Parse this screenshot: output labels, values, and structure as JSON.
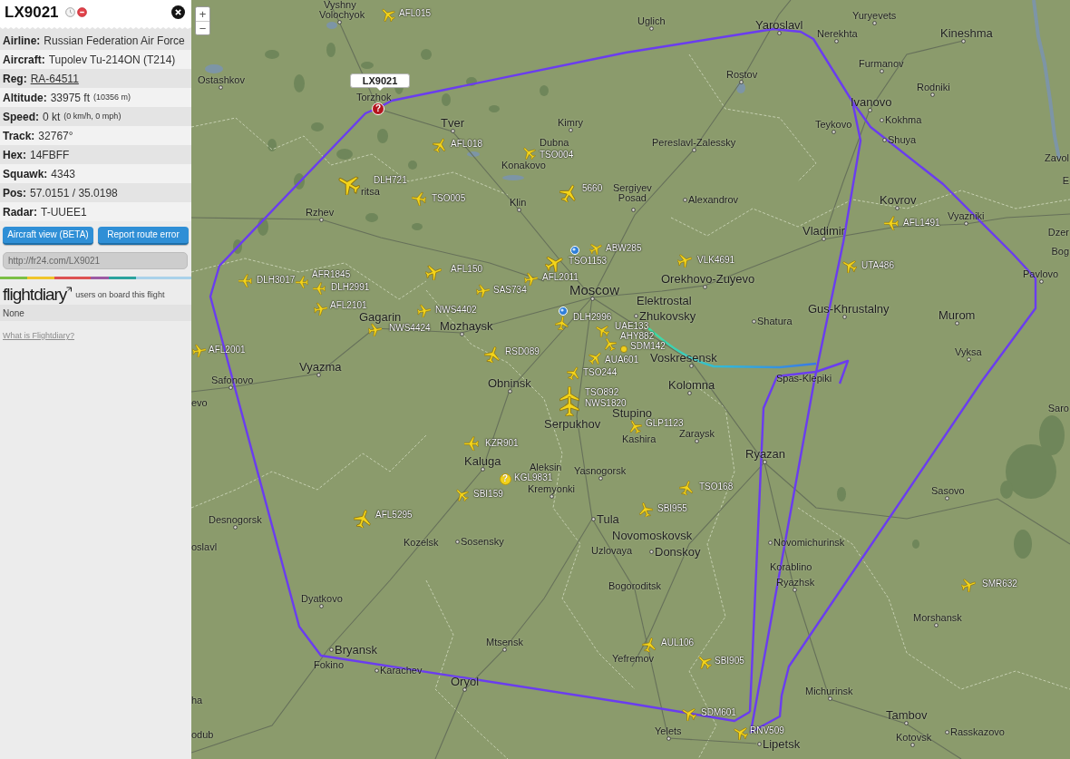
{
  "sidebar": {
    "title": "LX9021",
    "details": [
      {
        "label": "Airline:",
        "value": "Russian Federation Air Force",
        "kind": "text"
      },
      {
        "label": "Aircraft:",
        "value": "Tupolev Tu-214ON (T214)",
        "kind": "text"
      },
      {
        "label": "Reg:",
        "value": "RA-64511",
        "kind": "link"
      },
      {
        "label": "Altitude:",
        "value": "33975 ft",
        "note": "(10356 m)",
        "kind": "text"
      },
      {
        "label": "Speed:",
        "value": "0 kt",
        "note": "(0 km/h, 0 mph)",
        "kind": "text"
      },
      {
        "label": "Track:",
        "value": "32767°",
        "kind": "text"
      },
      {
        "label": "Hex:",
        "value": "14FBFF",
        "kind": "text"
      },
      {
        "label": "Squawk:",
        "value": "4343",
        "kind": "text"
      },
      {
        "label": "Pos:",
        "value": "57.0151 / 35.0198",
        "kind": "text"
      },
      {
        "label": "Radar:",
        "value": "T-UUEE1",
        "kind": "text"
      }
    ],
    "buttons": [
      "Aircraft view (BETA)",
      "Report route error"
    ],
    "share_url": "http://fr24.com/LX9021",
    "flightdiary": {
      "logo": "flightdiary",
      "caption": "users on board this flight",
      "passengers": "None",
      "help_link": "What is Flightdiary?"
    }
  },
  "map": {
    "zoom_buttons": [
      "+",
      "−"
    ],
    "selected_flight": {
      "callsign": "LX9021",
      "marker": "?"
    },
    "cities": [
      {
        "name": "Vyshny",
        "kind": "town"
      },
      {
        "name": "Volochyok",
        "kind": "town"
      },
      {
        "name": "Uglich",
        "kind": "town"
      },
      {
        "name": "Yaroslavl",
        "kind": "major"
      },
      {
        "name": "Yuryevets",
        "kind": "town"
      },
      {
        "name": "Nerekhta",
        "kind": "town"
      },
      {
        "name": "Kineshma",
        "kind": "major"
      },
      {
        "name": "Furmanov",
        "kind": "town"
      },
      {
        "name": "Ostashkov",
        "kind": "town"
      },
      {
        "name": "Rostov",
        "kind": "town"
      },
      {
        "name": "Rodniki",
        "kind": "town"
      },
      {
        "name": "Torzhok",
        "kind": "town"
      },
      {
        "name": "Ivanovo",
        "kind": "major"
      },
      {
        "name": "Tver",
        "kind": "major"
      },
      {
        "name": "Kimry",
        "kind": "town"
      },
      {
        "name": "Teykovo",
        "kind": "town"
      },
      {
        "name": "Kokhma",
        "kind": "town"
      },
      {
        "name": "Dubna",
        "kind": "town"
      },
      {
        "name": "Pereslavl-Zalessky",
        "kind": "town"
      },
      {
        "name": "Shuya",
        "kind": "town"
      },
      {
        "name": "Zavol",
        "kind": "town"
      },
      {
        "name": "Konakovo",
        "kind": "town"
      },
      {
        "name": "E",
        "kind": "town"
      },
      {
        "name": "ritsa",
        "kind": "town"
      },
      {
        "name": "Klin",
        "kind": "town"
      },
      {
        "name": "Sergiyev Posad",
        "kind": "town"
      },
      {
        "name": "Alexandrov",
        "kind": "town"
      },
      {
        "name": "Kovrov",
        "kind": "major"
      },
      {
        "name": "Rzhev",
        "kind": "town"
      },
      {
        "name": "Vyazniki",
        "kind": "town"
      },
      {
        "name": "Vladimir",
        "kind": "major"
      },
      {
        "name": "Dzer",
        "kind": "town"
      },
      {
        "name": "Bog",
        "kind": "town"
      },
      {
        "name": "Orekhovo-Zuyevo",
        "kind": "major"
      },
      {
        "name": "Pavlovo",
        "kind": "town"
      },
      {
        "name": "Moscow",
        "kind": "capital"
      },
      {
        "name": "Elektrostal",
        "kind": "major"
      },
      {
        "name": "Gagarin",
        "kind": "major"
      },
      {
        "name": "Mozhaysk",
        "kind": "major"
      },
      {
        "name": "Zhukovsky",
        "kind": "major"
      },
      {
        "name": "Shatura",
        "kind": "town"
      },
      {
        "name": "Gus-Khrustalny",
        "kind": "major"
      },
      {
        "name": "Murom",
        "kind": "major"
      },
      {
        "name": "Voskresensk",
        "kind": "major"
      },
      {
        "name": "Vyksa",
        "kind": "town"
      },
      {
        "name": "Vyazma",
        "kind": "major"
      },
      {
        "name": "Safonovo",
        "kind": "town"
      },
      {
        "name": "Obninsk",
        "kind": "major"
      },
      {
        "name": "Kolomna",
        "kind": "major"
      },
      {
        "name": "Spas-Klepiki",
        "kind": "town"
      },
      {
        "name": "evo",
        "kind": "town"
      },
      {
        "name": "Stupino",
        "kind": "major"
      },
      {
        "name": "Saro",
        "kind": "town"
      },
      {
        "name": "Serpukhov",
        "kind": "major"
      },
      {
        "name": "Kashira",
        "kind": "town"
      },
      {
        "name": "Zaraysk",
        "kind": "town"
      },
      {
        "name": "Ryazan",
        "kind": "major"
      },
      {
        "name": "Kaluga",
        "kind": "major"
      },
      {
        "name": "Aleksin",
        "kind": "town"
      },
      {
        "name": "Yasnogorsk",
        "kind": "town"
      },
      {
        "name": "Kremyonki",
        "kind": "town"
      },
      {
        "name": "Sasovo",
        "kind": "town"
      },
      {
        "name": "Desnogorsk",
        "kind": "town"
      },
      {
        "name": "Tula",
        "kind": "major"
      },
      {
        "name": "oslavl",
        "kind": "town"
      },
      {
        "name": "Kozelsk",
        "kind": "town"
      },
      {
        "name": "Sosensky",
        "kind": "town"
      },
      {
        "name": "Uzlovaya",
        "kind": "town"
      },
      {
        "name": "Novomoskovsk",
        "kind": "major"
      },
      {
        "name": "Donskoy",
        "kind": "major"
      },
      {
        "name": "Novomichurinsk",
        "kind": "town"
      },
      {
        "name": "Korablino",
        "kind": "town"
      },
      {
        "name": "Bogoroditsk",
        "kind": "town"
      },
      {
        "name": "Ryazhsk",
        "kind": "town"
      },
      {
        "name": "Dyatkovo",
        "kind": "town"
      },
      {
        "name": "Morshansk",
        "kind": "town"
      },
      {
        "name": "Mtsensk",
        "kind": "town"
      },
      {
        "name": "Bryansk",
        "kind": "major"
      },
      {
        "name": "Fokino",
        "kind": "town"
      },
      {
        "name": "Karachev",
        "kind": "town"
      },
      {
        "name": "Yefremov",
        "kind": "town"
      },
      {
        "name": "Oryol",
        "kind": "major"
      },
      {
        "name": "Michurinsk",
        "kind": "town"
      },
      {
        "name": "ha",
        "kind": "town"
      },
      {
        "name": "Tambov",
        "kind": "major"
      },
      {
        "name": "odub",
        "kind": "town"
      },
      {
        "name": "Yelets",
        "kind": "town"
      },
      {
        "name": "Lipetsk",
        "kind": "major"
      },
      {
        "name": "Kotovsk",
        "kind": "town"
      },
      {
        "name": "Rasskazovo",
        "kind": "town"
      }
    ],
    "flights": [
      {
        "callsign": "AFL015",
        "kind": "plane"
      },
      {
        "callsign": "AFL018",
        "kind": "plane"
      },
      {
        "callsign": "TSO004",
        "kind": "plane"
      },
      {
        "callsign": "DLH721",
        "kind": "plane"
      },
      {
        "callsign": "5660",
        "kind": "plane"
      },
      {
        "callsign": "TSO005",
        "kind": "plane"
      },
      {
        "callsign": "AFL1491",
        "kind": "plane"
      },
      {
        "callsign": "ABW285",
        "kind": "plane"
      },
      {
        "callsign": "DLH3017",
        "kind": "plane"
      },
      {
        "callsign": "AFR1845",
        "kind": "plane"
      },
      {
        "callsign": "AFL150",
        "kind": "plane"
      },
      {
        "callsign": "AFL2011",
        "kind": "plane"
      },
      {
        "callsign": "TSO1153",
        "kind": "plane"
      },
      {
        "callsign": "VLK4691",
        "kind": "plane"
      },
      {
        "callsign": "UTA486",
        "kind": "plane"
      },
      {
        "callsign": "DLH2991",
        "kind": "plane"
      },
      {
        "callsign": "SAS734",
        "kind": "plane"
      },
      {
        "callsign": "AFL2101",
        "kind": "plane"
      },
      {
        "callsign": "NWS4402",
        "kind": "plane"
      },
      {
        "callsign": "DLH2996",
        "kind": "plane"
      },
      {
        "callsign": "NWS4424",
        "kind": "plane"
      },
      {
        "callsign": "UAE133",
        "kind": "plane"
      },
      {
        "callsign": "AHY882",
        "kind": "plane"
      },
      {
        "callsign": "AFL2001",
        "kind": "plane"
      },
      {
        "callsign": "RSD089",
        "kind": "plane"
      },
      {
        "callsign": "SDM142",
        "kind": "dot"
      },
      {
        "callsign": "AUA601",
        "kind": "plane"
      },
      {
        "callsign": "TSO244",
        "kind": "plane"
      },
      {
        "callsign": "TSO892",
        "kind": "plane"
      },
      {
        "callsign": "NWS1820",
        "kind": "plane"
      },
      {
        "callsign": "GLP1123",
        "kind": "plane"
      },
      {
        "callsign": "KZR901",
        "kind": "plane"
      },
      {
        "callsign": "KGL9831",
        "kind": "unknown",
        "marker": "?"
      },
      {
        "callsign": "TSO168",
        "kind": "plane"
      },
      {
        "callsign": "SBI159",
        "kind": "plane"
      },
      {
        "callsign": "AFL5295",
        "kind": "plane"
      },
      {
        "callsign": "SBI955",
        "kind": "plane"
      },
      {
        "callsign": "SMR632",
        "kind": "plane"
      },
      {
        "callsign": "AUL106",
        "kind": "plane"
      },
      {
        "callsign": "SBI905",
        "kind": "plane"
      },
      {
        "callsign": "SDM601",
        "kind": "plane"
      },
      {
        "callsign": "RNV509",
        "kind": "plane"
      }
    ]
  }
}
